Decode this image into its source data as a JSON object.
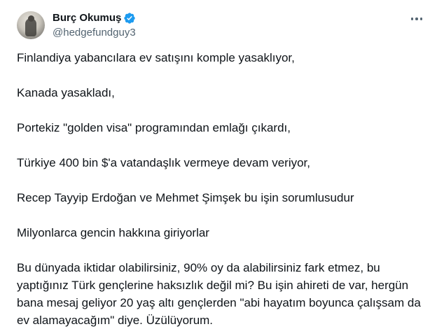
{
  "author": {
    "display_name": "Burç Okumuş",
    "handle": "@hedgefundguy3",
    "verified": true,
    "verified_color": "#1d9bf0"
  },
  "icons": {
    "more": "more-horizontal-icon",
    "verified": "verified-badge-icon"
  },
  "tweet": {
    "paragraphs": [
      "Finlandiya yabancılara ev satışını komple yasaklıyor,",
      "Kanada yasakladı,",
      "Portekiz \"golden visa\" programından emlağı çıkardı,",
      "Türkiye 400 bin $'a vatandaşlık vermeye devam veriyor,",
      "Recep Tayyip Erdoğan ve Mehmet Şimşek bu işin sorumlusudur",
      "Milyonlarca gencin hakkına giriyorlar",
      "Bu dünyada iktidar olabilirsiniz, 90% oy da alabilirsiniz fark etmez, bu yaptığınız Türk gençlerine haksızlık değil mi? Bu işin ahireti de var, hergün bana mesaj geliyor 20 yaş altı gençlerden \"abi hayatım boyunca çalışsam da ev alamayacağım\" diye. Üzülüyorum."
    ]
  },
  "colors": {
    "text_primary": "#0f1419",
    "text_secondary": "#536471",
    "background": "#ffffff"
  }
}
